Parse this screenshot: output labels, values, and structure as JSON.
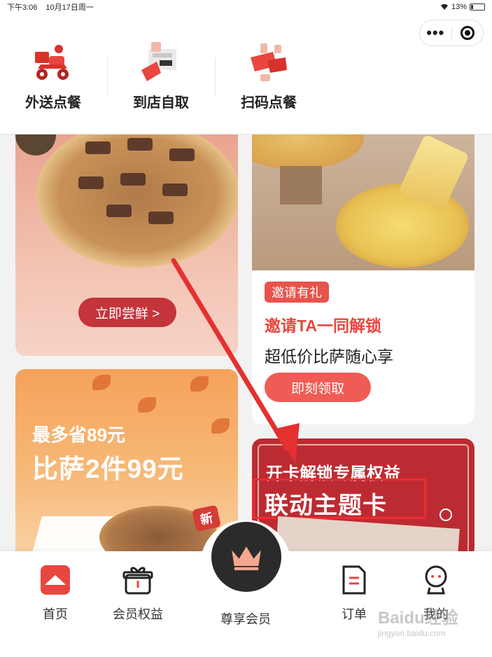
{
  "status": {
    "time": "下午3:06",
    "date": "10月17日周一",
    "battery": "13%"
  },
  "capsule": {
    "more_glyph": "•••"
  },
  "services": [
    {
      "label": "外送点餐",
      "icon": "delivery-scooter-icon"
    },
    {
      "label": "到店自取",
      "icon": "pickup-icon"
    },
    {
      "label": "扫码点餐",
      "icon": "scan-order-icon"
    }
  ],
  "cards": {
    "pizza": {
      "button": "立即尝鲜 >"
    },
    "invite": {
      "badge": "邀请有礼",
      "title": "邀请TA一同解锁",
      "subtitle": "超低价比萨随心享",
      "button": "即刻领取"
    },
    "promo": {
      "line1": "最多省89元",
      "line2": "比萨2件99元",
      "tag": "新"
    },
    "theme": {
      "line1": "开卡解锁专属权益",
      "line2": "联动主题卡"
    }
  },
  "tabbar": [
    {
      "label": "首页",
      "icon": "home-icon",
      "active": true
    },
    {
      "label": "会员权益",
      "icon": "gift-icon"
    },
    {
      "label": "尊享会员",
      "icon": "crown-icon"
    },
    {
      "label": "订单",
      "icon": "order-document-icon"
    },
    {
      "label": "我的",
      "icon": "profile-icon"
    }
  ],
  "watermark": {
    "brand": "Baidu经验",
    "url": "jingyan.baidu.com"
  },
  "colors": {
    "brand_red": "#e8463f",
    "tab_active": "#e8463f",
    "arrow": "#e53030"
  }
}
